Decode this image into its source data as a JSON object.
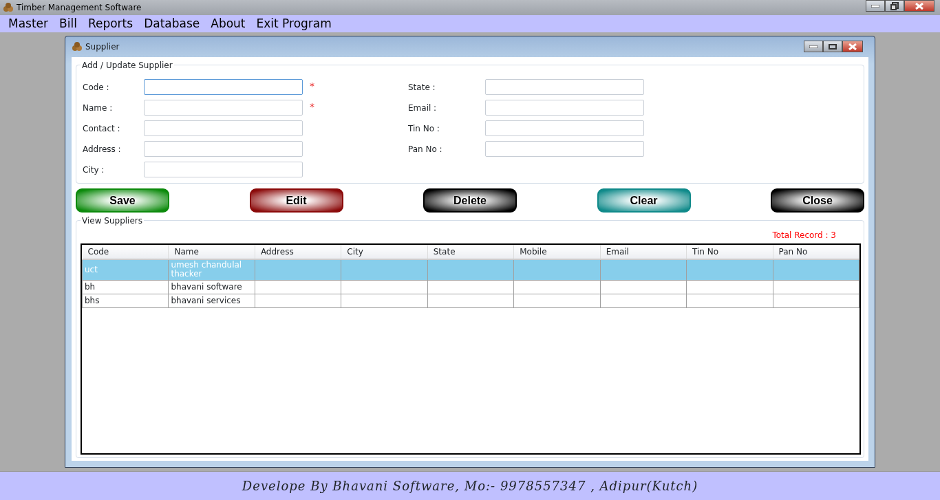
{
  "window": {
    "title": "Timber Management Software"
  },
  "menu": [
    "Master",
    "Bill",
    "Reports",
    "Database",
    "About",
    "Exit Program"
  ],
  "child_window": {
    "title": "Supplier"
  },
  "form": {
    "legend": "Add / Update Supplier",
    "left_fields": [
      {
        "label": "Code :",
        "required": true,
        "focused": true
      },
      {
        "label": "Name :",
        "required": true,
        "focused": false
      },
      {
        "label": "Contact :",
        "required": false,
        "focused": false
      },
      {
        "label": "Address :",
        "required": false,
        "focused": false
      },
      {
        "label": "City :",
        "required": false,
        "focused": false
      }
    ],
    "right_fields": [
      {
        "label": "State :"
      },
      {
        "label": "Email :"
      },
      {
        "label": "Tin No :"
      },
      {
        "label": "Pan No :"
      }
    ],
    "required_mark": "*"
  },
  "buttons": [
    {
      "label": "Save",
      "color": "#0c8a0c"
    },
    {
      "label": "Edit",
      "color": "#8b0a0a"
    },
    {
      "label": "Delete",
      "color": "#000000"
    },
    {
      "label": "Clear",
      "color": "#108a8a"
    },
    {
      "label": "Close",
      "color": "#000000"
    }
  ],
  "view": {
    "legend": "View Suppliers",
    "total": "Total Record : 3",
    "table": {
      "columns": [
        "Code",
        "Name",
        "Address",
        "City",
        "State",
        "Mobile",
        "Email",
        "Tin No",
        "Pan No"
      ],
      "rows": [
        {
          "selected": true,
          "cells": [
            "uct",
            "umesh chandulal thacker",
            "",
            "",
            "",
            "",
            "",
            "",
            ""
          ]
        },
        {
          "selected": false,
          "cells": [
            "bh",
            "bhavani software",
            "",
            "",
            "",
            "",
            "",
            "",
            ""
          ]
        },
        {
          "selected": false,
          "cells": [
            "bhs",
            "bhavani services",
            "",
            "",
            "",
            "",
            "",
            "",
            ""
          ]
        }
      ]
    }
  },
  "footer": "Develope By Bhavani Software, Mo:- 9978557347 , Adipur(Kutch)"
}
